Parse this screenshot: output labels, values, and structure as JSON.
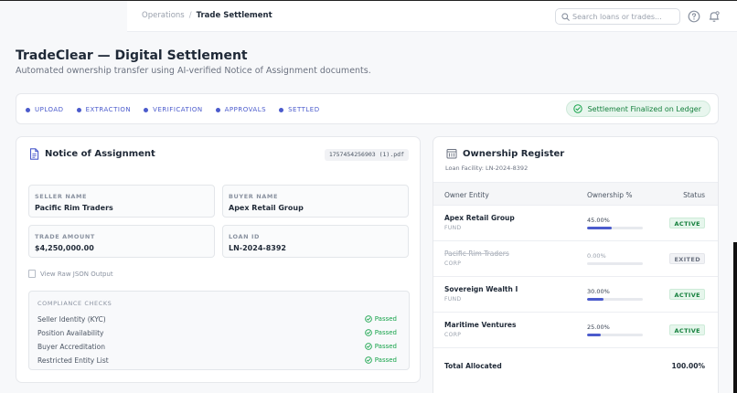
{
  "breadcrumb": {
    "parent": "Operations",
    "separator": "/",
    "current": "Trade Settlement"
  },
  "search": {
    "placeholder": "Search loans or trades..."
  },
  "page": {
    "title": "TradeClear — Digital Settlement",
    "subtitle": "Automated ownership transfer using AI-verified Notice of Assignment documents."
  },
  "steps": [
    "UPLOAD",
    "EXTRACTION",
    "VERIFICATION",
    "APPROVALS",
    "SETTLED"
  ],
  "status_banner": "Settlement Finalized on Ledger",
  "notice": {
    "title": "Notice of Assignment",
    "file_name": "1757454256903 (1).pdf",
    "fields": {
      "seller": {
        "label": "SELLER NAME",
        "value": "Pacific Rim Traders"
      },
      "buyer": {
        "label": "BUYER NAME",
        "value": "Apex Retail Group"
      },
      "amount": {
        "label": "TRADE AMOUNT",
        "value": "$4,250,000.00"
      },
      "loan": {
        "label": "LOAN ID",
        "value": "LN-2024-8392"
      }
    },
    "raw_json_label": "View Raw JSON Output",
    "compliance": {
      "title": "COMPLIANCE CHECKS",
      "checks": [
        {
          "name": "Seller Identity (KYC)",
          "status": "Passed"
        },
        {
          "name": "Position Availability",
          "status": "Passed"
        },
        {
          "name": "Buyer Accreditation",
          "status": "Passed"
        },
        {
          "name": "Restricted Entity List",
          "status": "Passed"
        }
      ]
    }
  },
  "register": {
    "title": "Ownership Register",
    "subtitle": "Loan Facility: LN-2024-8392",
    "columns": [
      "Owner Entity",
      "Ownership %",
      "Status"
    ],
    "rows": [
      {
        "entity": "Apex Retail Group",
        "type": "FUND",
        "pct": "45.00%",
        "share": 0.45,
        "status": "ACTIVE"
      },
      {
        "entity": "Pacific Rim Traders",
        "type": "CORP",
        "pct": "0.00%",
        "share": 0.0,
        "status": "EXITED"
      },
      {
        "entity": "Sovereign Wealth I",
        "type": "FUND",
        "pct": "30.00%",
        "share": 0.3,
        "status": "ACTIVE"
      },
      {
        "entity": "Maritime Ventures",
        "type": "CORP",
        "pct": "25.00%",
        "share": 0.25,
        "status": "ACTIVE"
      }
    ],
    "total_label": "Total Allocated",
    "total_value": "100.00%"
  },
  "colors": {
    "accent": "#4b5bcc",
    "success": "#15803d"
  }
}
